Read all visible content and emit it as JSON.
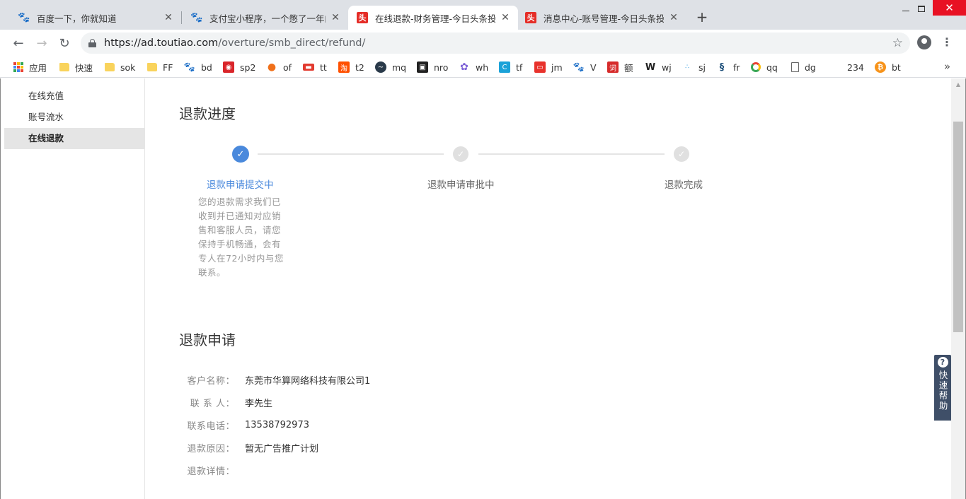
{
  "tabs": [
    {
      "title": "百度一下，你就知道",
      "icon": "baidu-paw-icon"
    },
    {
      "title": "支付宝小程序，一个憋了一年的大",
      "icon": "baidu-paw-icon"
    },
    {
      "title": "在线退款-财务管理-今日头条投放",
      "icon": "toutiao-icon"
    },
    {
      "title": "消息中心-账号管理-今日头条投放",
      "icon": "toutiao-icon"
    }
  ],
  "toutiao_glyph": "头",
  "address": {
    "host": "https://ad.toutiao.com",
    "path": "/overture/smb_direct/refund/"
  },
  "bookmarks": [
    {
      "label": "应用",
      "icon": "apps-grid-icon"
    },
    {
      "label": "快速",
      "icon": "folder-icon"
    },
    {
      "label": "sok",
      "icon": "folder-icon"
    },
    {
      "label": "FF",
      "icon": "folder-icon"
    },
    {
      "label": "bd",
      "icon": "baidu-paw-icon"
    },
    {
      "label": "sp2",
      "icon": "wifi-icon"
    },
    {
      "label": "of",
      "icon": "flame-icon"
    },
    {
      "label": "tt",
      "icon": "red-badge-icon"
    },
    {
      "label": "t2",
      "icon": "taobao-icon"
    },
    {
      "label": "mq",
      "icon": "wave-icon"
    },
    {
      "label": "nro",
      "icon": "bag-icon"
    },
    {
      "label": "wh",
      "icon": "pinwheel-icon"
    },
    {
      "label": "tf",
      "icon": "cyan-square-icon"
    },
    {
      "label": "jm",
      "icon": "red-box-icon"
    },
    {
      "label": "V",
      "icon": "baidu-paw-icon"
    },
    {
      "label": "额",
      "icon": "ci-icon"
    },
    {
      "label": "wj",
      "icon": "w-logo-icon"
    },
    {
      "label": "sj",
      "icon": "drops-icon"
    },
    {
      "label": "fr",
      "icon": "chain-icon"
    },
    {
      "label": "qq",
      "icon": "color-ring-icon"
    },
    {
      "label": "dg",
      "icon": "page-icon"
    },
    {
      "label": "234",
      "icon": ""
    },
    {
      "label": "bt",
      "icon": "bitcoin-icon"
    }
  ],
  "sidebar": {
    "items": [
      {
        "label": "在线充值"
      },
      {
        "label": "账号流水"
      },
      {
        "label": "在线退款"
      }
    ]
  },
  "progress": {
    "title": "退款进度",
    "steps": [
      {
        "label": "退款申请提交中",
        "state": "current"
      },
      {
        "label": "退款申请审批中",
        "state": "pending"
      },
      {
        "label": "退款完成",
        "state": "pending"
      }
    ],
    "description": "您的退款需求我们已收到并已通知对应销售和客服人员，请您保持手机畅通，会有专人在72小时内与您联系。"
  },
  "application": {
    "title": "退款申请",
    "fields": [
      {
        "label": "客户名称：",
        "value": "东莞市华算网络科技有限公司1"
      },
      {
        "label": "联 系 人：",
        "value": "李先生"
      },
      {
        "label": "联系电话：",
        "value": "13538792973"
      },
      {
        "label": "退款原因：",
        "value": "暂无广告推广计划"
      },
      {
        "label": "退款详情：",
        "value": ""
      }
    ]
  },
  "help": {
    "label": "快速帮助",
    "icon_glyph": "?"
  },
  "colors": {
    "accent": "#4a89dc",
    "tab_strip": "#dee1e6",
    "help_bg": "#3f4f68"
  }
}
